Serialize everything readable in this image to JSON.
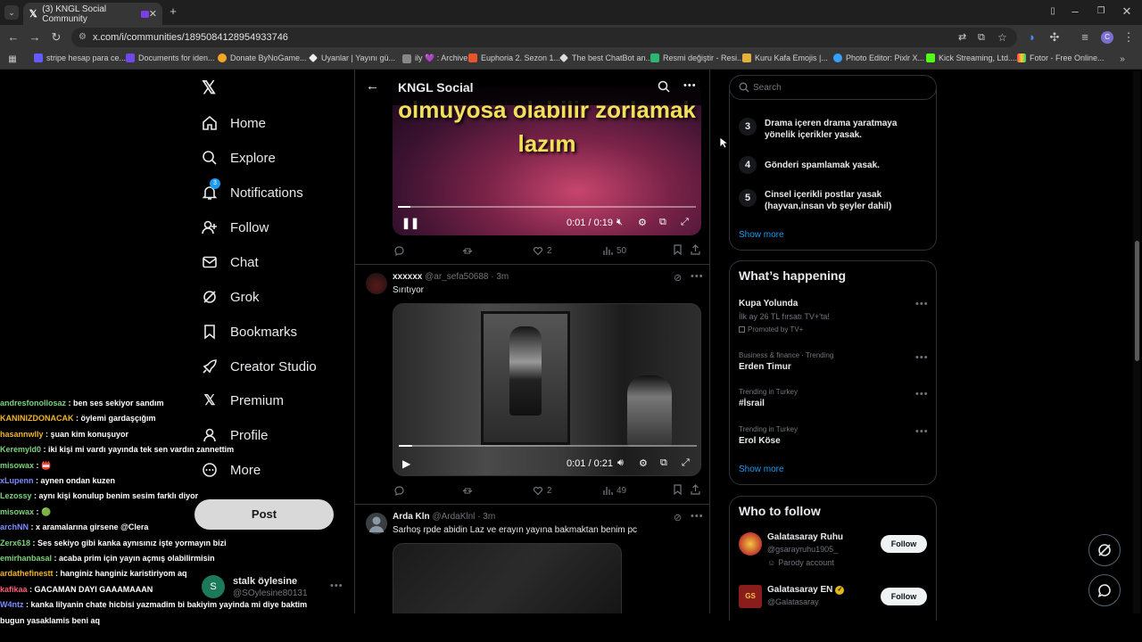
{
  "browser": {
    "tab_title": "(3) KNGL Social Community",
    "url": "x.com/i/communities/1895084128954933746",
    "bookmarks": [
      "stripe hesap para ce...",
      "Documents for iden...",
      "Donate ByNoGame...",
      "Uyanlar | Yayını gü...",
      "ily 💜 : Archive",
      "Euphoria 2. Sezon 1...",
      "The best ChatBot an...",
      "Resmi değiştir - Resi...",
      "Kuru Kafa Emojis |...",
      "Photo Editor: Pixlr X...",
      "Kick Streaming, Ltd....",
      "Fotor - Free Online..."
    ]
  },
  "nav": {
    "items": [
      "Home",
      "Explore",
      "Notifications",
      "Follow",
      "Chat",
      "Grok",
      "Bookmarks",
      "Creator Studio",
      "Premium",
      "Profile",
      "More"
    ],
    "notifications_badge": "3",
    "post_label": "Post",
    "account_name": "stalk öylesine",
    "account_handle": "@SOylesine80131",
    "account_initial": "S"
  },
  "chat": [
    {
      "user": "andresfonollosaz",
      "text": " : ben ses sekiyor sandım",
      "color": "#7bd37b"
    },
    {
      "user": "KANINIZDONACAK",
      "text": " : öylemi gardaşçığım",
      "color": "#f0b429"
    },
    {
      "user": "hasannwlly",
      "text": " : şuan kim konuşuyor",
      "color": "#f0b429"
    },
    {
      "user": "Keremyld0",
      "text": " : iki kişi mi vardı yayında tek sen vardın zannettim",
      "color": "#7bd37b"
    },
    {
      "user": "misowax",
      "text": " : 📛",
      "color": "#7bd37b"
    },
    {
      "user": "xLupenn",
      "text": " : aynen ondan kuzen",
      "color": "#7b8cff"
    },
    {
      "user": "Lezossy",
      "text": " : aynı kişi konulup benim sesim farklı diyor",
      "color": "#7bd37b"
    },
    {
      "user": "misowax",
      "text": " : 🟢",
      "color": "#7bd37b"
    },
    {
      "user": "archNN",
      "text": " : x aramalarına girsene @Clera",
      "color": "#7b8cff"
    },
    {
      "user": "Zerx618",
      "text": " : Ses sekiyo gibi kanka aynısınız işte yormayın bizi",
      "color": "#7bd37b"
    },
    {
      "user": "emirhanbasal",
      "text": " : acaba prim için yayın açmış olabilirmisin",
      "color": "#7bd37b"
    },
    {
      "user": "ardathefinestt",
      "text": " : hanginiz hanginiz karistiriyom aq",
      "color": "#f0b429"
    },
    {
      "user": "kafikaa",
      "text": " : GACAMAN DAYI GAAAMAAAN",
      "color": "#ff5a7a"
    },
    {
      "user": "W4ntz",
      "text": " : kanka lilyanin chate hicbisi yazmadim bi bakiyim yayinda mi diye baktim",
      "color": "#7b8cff"
    },
    {
      "user": "",
      "text": "bugun yasaklamis beni aq",
      "color": "#fff"
    }
  ],
  "header": {
    "title": "KNGL Social"
  },
  "posts": [
    {
      "video_caption": "olmuyosa olabilir zorlamak lazım",
      "time": "0:01 / 0:19",
      "likes": "2",
      "views": "50"
    },
    {
      "name": "xxxxxx",
      "handle": "@ar_sefa50688",
      "age": "3m",
      "text": "Sırıtıyor",
      "time": "0:01 / 0:21",
      "likes": "2",
      "views": "49"
    },
    {
      "name": "Arda Kln",
      "handle": "@ArdaKlnl",
      "age": "3m",
      "text": "Sarhoş rpde abidin Laz ve erayın yayına bakmaktan benim pc"
    }
  ],
  "search": {
    "placeholder": "Search"
  },
  "rules": [
    {
      "num": "3",
      "text": "Drama içeren drama yaratmaya yönelik içerikler yasak."
    },
    {
      "num": "4",
      "text": "Gönderi spamlamak yasak."
    },
    {
      "num": "5",
      "text": "Cinsel içerikli postlar yasak (hayvan,insan vb şeyler dahil)"
    }
  ],
  "rules_show_more": "Show more",
  "happening": {
    "title": "What’s happening",
    "trends": [
      {
        "title": "Kupa Yolunda",
        "sub": "İlk ay 26 TL fırsatı TV+'ta!",
        "meta": "Promoted by TV+"
      },
      {
        "meta": "Business & finance · Trending",
        "title": "Erden Timur"
      },
      {
        "meta": "Trending in Turkey",
        "title": "#İsrail"
      },
      {
        "meta": "Trending in Turkey",
        "title": "Erol Köse"
      }
    ],
    "show_more": "Show more"
  },
  "who_to_follow": {
    "title": "Who to follow",
    "accounts": [
      {
        "name": "Galatasaray Ruhu",
        "handle": "@gsarayruhu1905_",
        "note": "Parody account",
        "button": "Follow"
      },
      {
        "name": "Galatasaray EN",
        "handle": "@Galatasaray",
        "button": "Follow"
      }
    ]
  }
}
